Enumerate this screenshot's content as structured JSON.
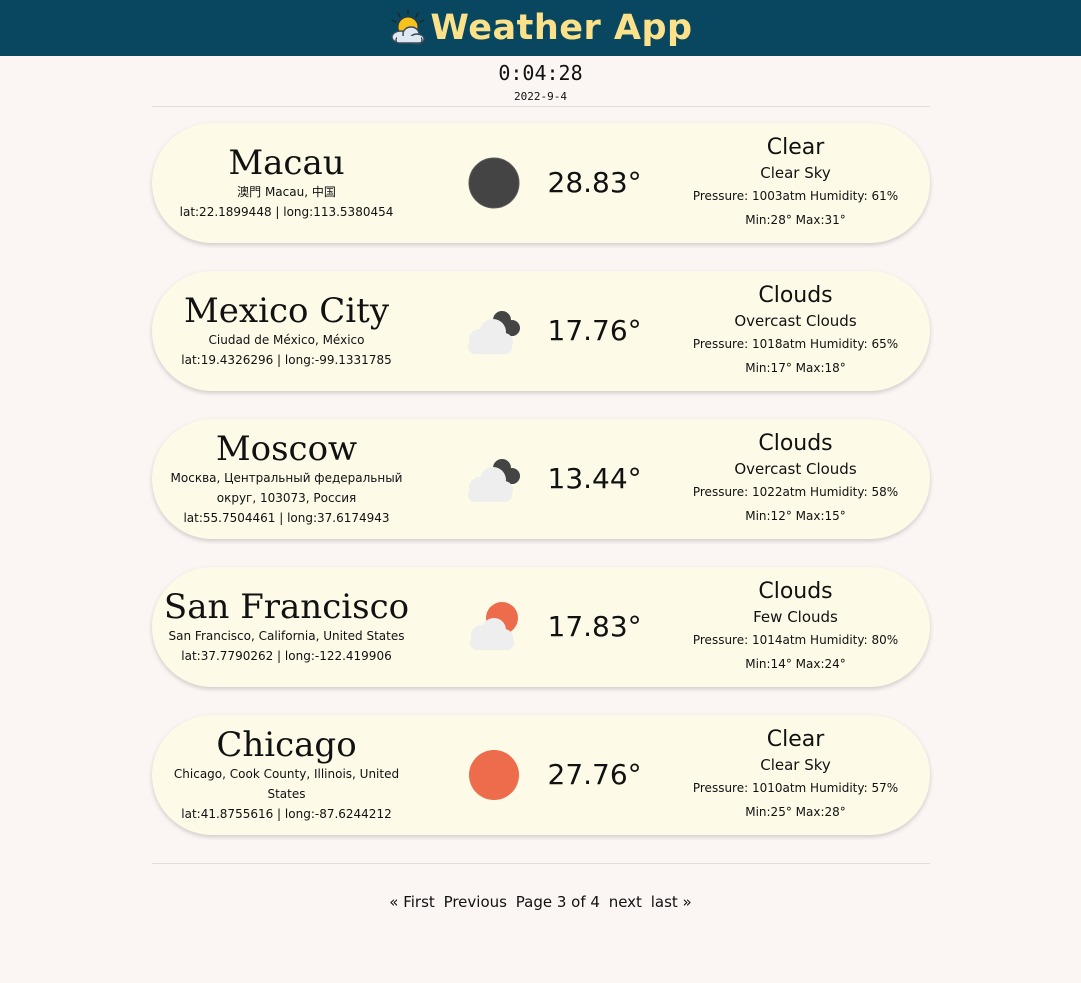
{
  "header": {
    "title": "Weather App",
    "logo_icon": "sun-behind-cloud-icon"
  },
  "clock": {
    "time": "0:04:28",
    "date": "2022-9-4"
  },
  "colors": {
    "header_bg": "#08475f",
    "title": "#fbe28a",
    "card_bg": "#fdfae8",
    "sun_day": "#ec6c4c",
    "moon_night": "#444444"
  },
  "cards": [
    {
      "city": "Macau",
      "address": "澳門 Macau, 中国",
      "coords": "lat:22.1899448 | long:113.5380454",
      "icon": "night-clear-icon",
      "temp": "28.83°",
      "main": "Clear",
      "description": "Clear Sky",
      "stats": "Pressure: 1003atm Humidity: 61%",
      "minmax": "Min:28° Max:31°"
    },
    {
      "city": "Mexico City",
      "address": "Ciudad de México, México",
      "coords": "lat:19.4326296 | long:-99.1331785",
      "icon": "overcast-clouds-icon",
      "temp": "17.76°",
      "main": "Clouds",
      "description": "Overcast Clouds",
      "stats": "Pressure: 1018atm Humidity: 65%",
      "minmax": "Min:17° Max:18°"
    },
    {
      "city": "Moscow",
      "address": "Москва, Центральный федеральный округ, 103073, Россия",
      "coords": "lat:55.7504461 | long:37.6174943",
      "icon": "overcast-clouds-icon",
      "temp": "13.44°",
      "main": "Clouds",
      "description": "Overcast Clouds",
      "stats": "Pressure: 1022atm Humidity: 58%",
      "minmax": "Min:12° Max:15°"
    },
    {
      "city": "San Francisco",
      "address": "San Francisco, California, United States",
      "coords": "lat:37.7790262 | long:-122.419906",
      "icon": "few-clouds-day-icon",
      "temp": "17.83°",
      "main": "Clouds",
      "description": "Few Clouds",
      "stats": "Pressure: 1014atm Humidity: 80%",
      "minmax": "Min:14° Max:24°"
    },
    {
      "city": "Chicago",
      "address": "Chicago, Cook County, Illinois, United States",
      "coords": "lat:41.8755616 | long:-87.6244212",
      "icon": "clear-day-sun-icon",
      "temp": "27.76°",
      "main": "Clear",
      "description": "Clear Sky",
      "stats": "Pressure: 1010atm Humidity: 57%",
      "minmax": "Min:25° Max:28°"
    }
  ],
  "pagination": {
    "first": "« First",
    "previous": "Previous",
    "status": "Page 3 of 4",
    "next": "next",
    "last": "last »"
  }
}
